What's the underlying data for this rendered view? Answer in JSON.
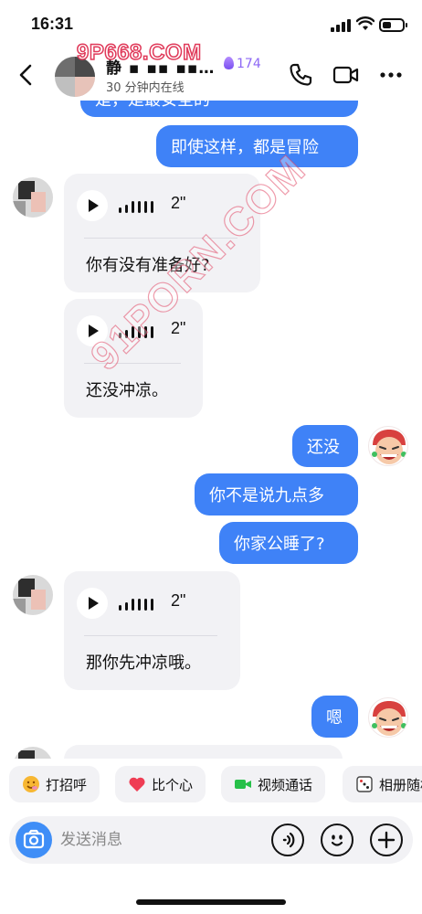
{
  "status_bar": {
    "time": "16:31"
  },
  "header": {
    "name": "静 ▪ ▪▪ ▪▪…",
    "score": "174",
    "status": "30 分钟内在线",
    "watermark": "9P668.COM"
  },
  "chat": {
    "watermark": "91PORN.COM",
    "messages": [
      {
        "side": "right",
        "text": "是，是最安全的"
      },
      {
        "side": "right",
        "text": "即使这样，都是冒险"
      },
      {
        "side": "left",
        "type": "voice",
        "duration": "2\"",
        "transcript": "你有没有准备好?"
      },
      {
        "side": "left",
        "type": "voice",
        "duration": "2\"",
        "transcript": "还没冲凉。"
      },
      {
        "side": "right",
        "text": "还没"
      },
      {
        "side": "right",
        "text": "你不是说九点多"
      },
      {
        "side": "right",
        "text": "你家公睡了?"
      },
      {
        "side": "left",
        "type": "voice",
        "duration": "2\"",
        "transcript": "那你先冲凉哦。"
      },
      {
        "side": "right",
        "text": "嗯"
      }
    ]
  },
  "quick_actions": [
    {
      "label": "打招呼",
      "icon": "smile-emoji-icon"
    },
    {
      "label": "比个心",
      "icon": "heart-icon"
    },
    {
      "label": "视频通话",
      "icon": "video-call-icon"
    },
    {
      "label": "相册随机",
      "icon": "dice-icon"
    }
  ],
  "input": {
    "placeholder": "发送消息"
  },
  "colors": {
    "accent": "#3f82f7",
    "bubble_left": "#f2f2f5",
    "score": "#8d68f5"
  }
}
